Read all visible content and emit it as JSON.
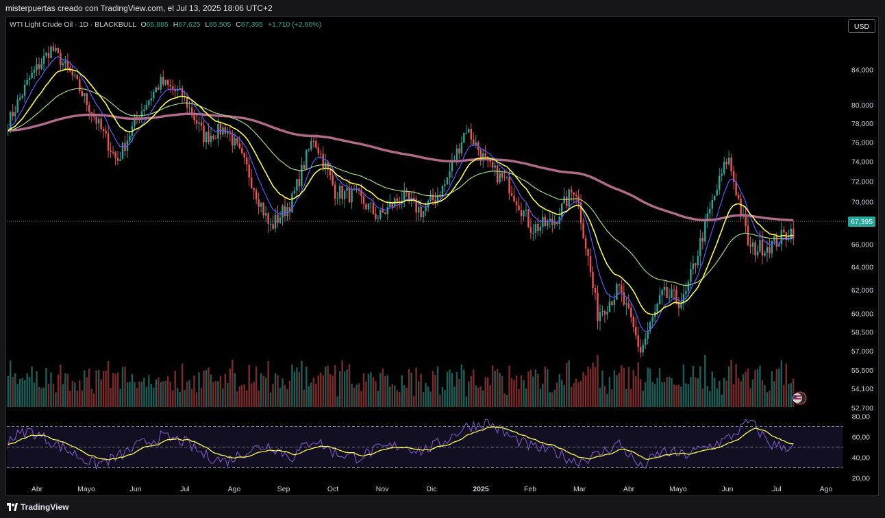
{
  "header": {
    "caption": "misterpuertas creado con TradingView.com, el Jul 13, 2025 18:06 UTC+2"
  },
  "legend": {
    "symbol": "WTI Light Crude Oil · 1D · BLACKBULL",
    "o_label": "O",
    "o_value": "65,885",
    "h_label": "H",
    "h_value": "67,625",
    "l_label": "L",
    "l_value": "65,505",
    "c_label": "C",
    "c_value": "67,395",
    "change": "+1,710 (+2,60%)"
  },
  "currency_button": "USD",
  "footer": {
    "brand": "TradingView"
  },
  "colors": {
    "up": "#26a69a",
    "down": "#ef5350",
    "ema_short": "#ffff4d",
    "ema_fast": "#5b5bff",
    "ema_mid": "#a8d97f",
    "ema_long": "#b06a8a",
    "rsi": "#7e57c2",
    "rsi_ma": "#ffff4d"
  },
  "chart_data": [
    {
      "type": "candlestick",
      "price_axis_ticks": [
        "84,000",
        "80,000",
        "78,000",
        "76,000",
        "74,000",
        "72,000",
        "70,000",
        "68,000",
        "66,000",
        "64,000",
        "62,000",
        "60,000",
        "58,500",
        "57,000",
        "55,500",
        "54,100",
        "52,700"
      ],
      "time_axis_ticks": [
        "Abr",
        "Mayo",
        "Jun",
        "Jul",
        "Ago",
        "Sep",
        "Oct",
        "Nov",
        "Dic",
        "2025",
        "Feb",
        "Mar",
        "Abr",
        "Mayo",
        "Jun",
        "Jul",
        "Ago"
      ],
      "last_price_label": "67,395",
      "log_scale": true,
      "ylim": [
        52.7,
        88
      ],
      "close_path": [
        [
          "Mar 2024",
          78.0
        ],
        [
          "Abr 2024",
          83.0
        ],
        [
          "Abr 2024",
          86.5
        ],
        [
          "Mayo 2024",
          83.0
        ],
        [
          "Mayo 2024",
          78.5
        ],
        [
          "Jun 2024",
          74.0
        ],
        [
          "Jun 2024",
          79.0
        ],
        [
          "Jul 2024",
          82.5
        ],
        [
          "Jul 2024",
          81.0
        ],
        [
          "Ago 2024",
          76.5
        ],
        [
          "Ago 2024",
          77.5
        ],
        [
          "Sep 2024",
          73.0
        ],
        [
          "Sep 2024",
          67.5
        ],
        [
          "Sep 2024",
          70.0
        ],
        [
          "Oct 2024",
          76.5
        ],
        [
          "Oct 2024",
          71.0
        ],
        [
          "Nov 2024",
          70.5
        ],
        [
          "Nov 2024",
          68.5
        ],
        [
          "Dic 2024",
          70.5
        ],
        [
          "Dic 2024",
          69.0
        ],
        [
          "2025",
          71.5
        ],
        [
          "2025",
          77.5
        ],
        [
          "Feb 2025",
          73.5
        ],
        [
          "Feb 2025",
          71.5
        ],
        [
          "Mar 2025",
          67.5
        ],
        [
          "Mar 2025",
          68.0
        ],
        [
          "Abr 2025",
          71.5
        ],
        [
          "Abr 2025",
          60.0
        ],
        [
          "Abr 2025",
          62.0
        ],
        [
          "Mayo 2025",
          57.0
        ],
        [
          "Mayo 2025",
          61.5
        ],
        [
          "Jun 2025",
          61.0
        ],
        [
          "Jun 2025",
          68.0
        ],
        [
          "Jun 2025",
          74.5
        ],
        [
          "Jun 2025",
          65.5
        ],
        [
          "Jul 2025",
          66.0
        ],
        [
          "Jul 2025",
          67.395
        ]
      ],
      "indicators": [
        "EMA short (yellow)",
        "EMA fast (blue)",
        "EMA mid (green)",
        "EMA long (mauve)",
        "Volume"
      ]
    },
    {
      "type": "line",
      "name": "RSI",
      "ylim": [
        15,
        85
      ],
      "y_ticks": [
        "80,00",
        "60,00",
        "40,00",
        "20,00"
      ],
      "bands": [
        30,
        50,
        70
      ],
      "values": [
        58,
        66,
        55,
        44,
        33,
        40,
        52,
        60,
        56,
        42,
        36,
        47,
        52,
        40,
        58,
        44,
        40,
        48,
        52,
        46,
        56,
        70,
        74,
        60,
        50,
        46,
        36,
        42,
        54,
        30,
        46,
        42,
        50,
        58,
        75,
        52,
        50
      ]
    }
  ]
}
